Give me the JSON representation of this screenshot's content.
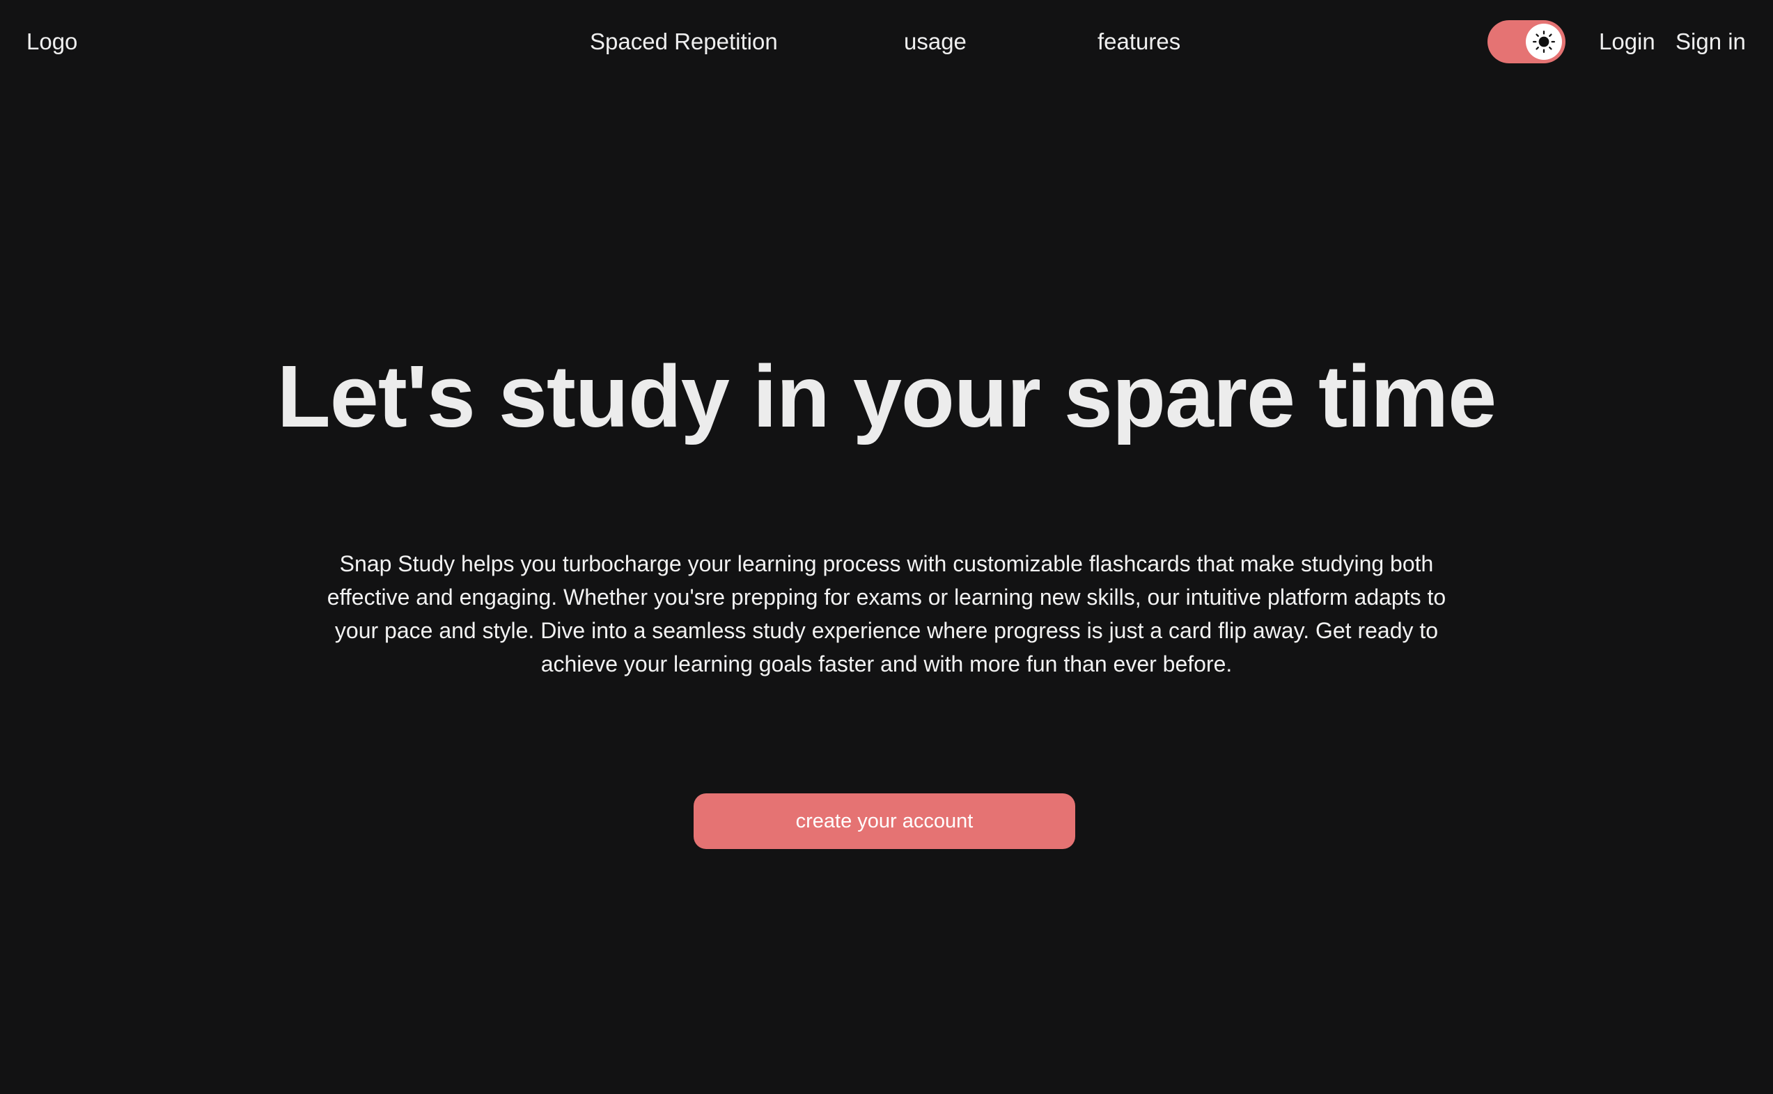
{
  "nav": {
    "logo": "Logo",
    "links": [
      {
        "label": "Spaced Repetition"
      },
      {
        "label": "usage"
      },
      {
        "label": "features"
      }
    ],
    "theme_toggle": {
      "state": "light",
      "icon": "sun-icon",
      "color": "#e57373"
    },
    "login_label": "Login",
    "signin_label": "Sign in"
  },
  "hero": {
    "title": "Let's study in your spare time",
    "description": "Snap Study helps you turbocharge your learning process with customizable flashcards that make studying both effective and engaging. Whether you'sre prepping for exams or learning new skills, our intuitive platform adapts to your pace and style. Dive into a seamless study experience where progress is just a card flip away. Get ready to achieve your learning goals faster and with more fun than ever before.",
    "cta_label": "create your account"
  },
  "colors": {
    "background": "#121213",
    "accent": "#e57373",
    "text": "#ececec"
  }
}
